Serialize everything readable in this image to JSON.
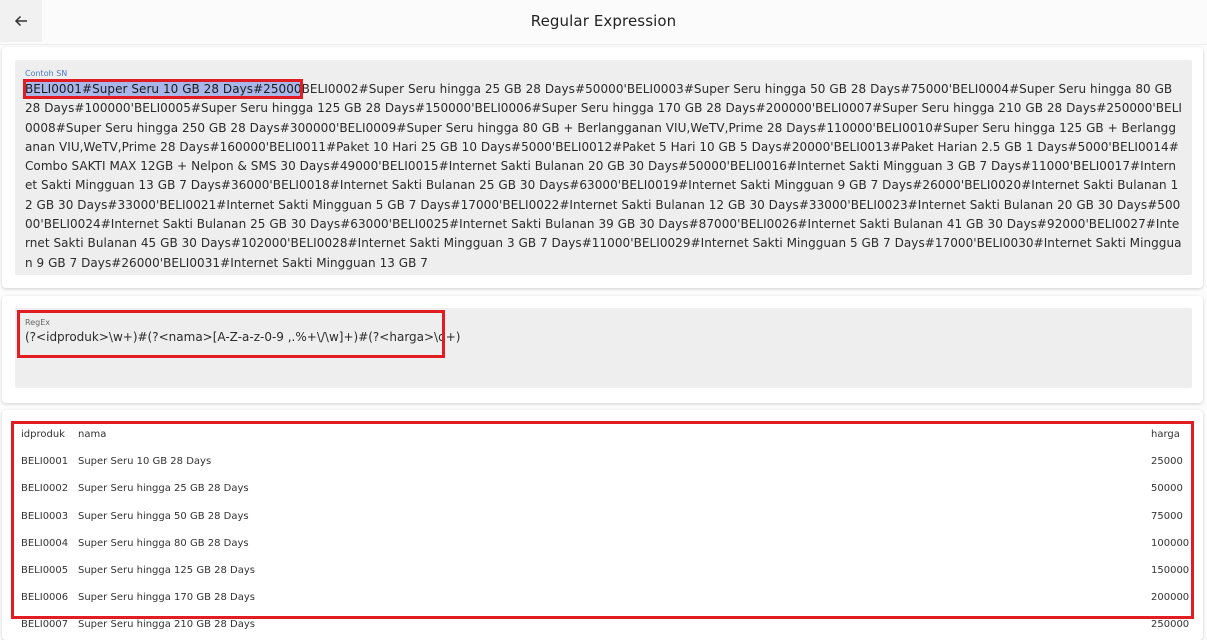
{
  "appbar": {
    "title": "Regular Expression",
    "back_icon": "arrow-left-icon"
  },
  "sample": {
    "label": "Contoh SN",
    "highlight": "BELI0001#Super Seru 10 GB 28 Days#25000",
    "rest": "BELI0002#Super Seru hingga 25 GB 28 Days#50000'BELI0003#Super Seru hingga 50 GB 28 Days#75000'BELI0004#Super Seru hingga 80 GB 28 Days#100000'BELI0005#Super Seru hingga 125 GB 28 Days#150000'BELI0006#Super Seru hingga 170 GB 28 Days#200000'BELI0007#Super Seru hingga 210 GB 28 Days#250000'BELI0008#Super Seru hingga 250 GB 28 Days#300000'BELI0009#Super Seru hingga 80 GB + Berlangganan VIU,WeTV,Prime 28 Days#110000'BELI0010#Super Seru hingga 125 GB + Berlangganan VIU,WeTV,Prime 28 Days#160000'BELI0011#Paket 10 Hari 25 GB 10 Days#5000'BELI0012#Paket 5 Hari 10 GB 5 Days#20000'BELI0013#Paket Harian 2.5 GB 1 Days#5000'BELI0014#Combo SAKTI MAX 12GB + Nelpon & SMS 30 Days#49000'BELI0015#Internet Sakti Bulanan 20 GB 30 Days#50000'BELI0016#Internet Sakti Mingguan 3 GB 7 Days#11000'BELI0017#Internet Sakti Mingguan 13 GB 7 Days#36000'BELI0018#Internet Sakti Bulanan 25 GB 30 Days#63000'BELI0019#Internet Sakti Mingguan 9 GB 7 Days#26000'BELI0020#Internet Sakti Bulanan 12 GB 30 Days#33000'BELI0021#Internet Sakti Mingguan 5 GB 7 Days#17000'BELI0022#Internet Sakti Bulanan 12 GB 30 Days#33000'BELI0023#Internet Sakti Bulanan 20 GB 30 Days#50000'BELI0024#Internet Sakti Bulanan 25 GB 30 Days#63000'BELI0025#Internet Sakti Bulanan 39 GB 30 Days#87000'BELI0026#Internet Sakti Bulanan 41 GB 30 Days#92000'BELI0027#Internet Sakti Bulanan 45 GB 30 Days#102000'BELI0028#Internet Sakti Mingguan 3 GB 7 Days#11000'BELI0029#Internet Sakti Mingguan 5 GB 7 Days#17000'BELI0030#Internet Sakti Mingguan 9 GB 7 Days#26000'BELI0031#Internet Sakti Mingguan 13 GB 7"
  },
  "regex": {
    "label": "RegEx",
    "value": "(?<idproduk>\\w+)#(?<nama>[A-Z-a-z-0-9 ,.%+\\/\\w]+)#(?<harga>\\d+)"
  },
  "table": {
    "headers": [
      "idproduk",
      "nama",
      "harga"
    ],
    "rows": [
      [
        "BELI0001",
        "Super Seru 10 GB 28 Days",
        "25000"
      ],
      [
        "BELI0002",
        "Super Seru hingga 25 GB 28 Days",
        "50000"
      ],
      [
        "BELI0003",
        "Super Seru hingga 50 GB 28 Days",
        "75000"
      ],
      [
        "BELI0004",
        "Super Seru hingga 80 GB 28 Days",
        "100000"
      ],
      [
        "BELI0005",
        "Super Seru hingga 125 GB 28 Days",
        "150000"
      ],
      [
        "BELI0006",
        "Super Seru hingga 170 GB 28 Days",
        "200000"
      ],
      [
        "BELI0007",
        "Super Seru hingga 210 GB 28 Days",
        "250000"
      ]
    ]
  },
  "colors": {
    "annotation_red": "#e21c23",
    "selection": "#a9b6ea",
    "label_blue": "#4a7ac9",
    "field_bg": "#eeeeee"
  }
}
